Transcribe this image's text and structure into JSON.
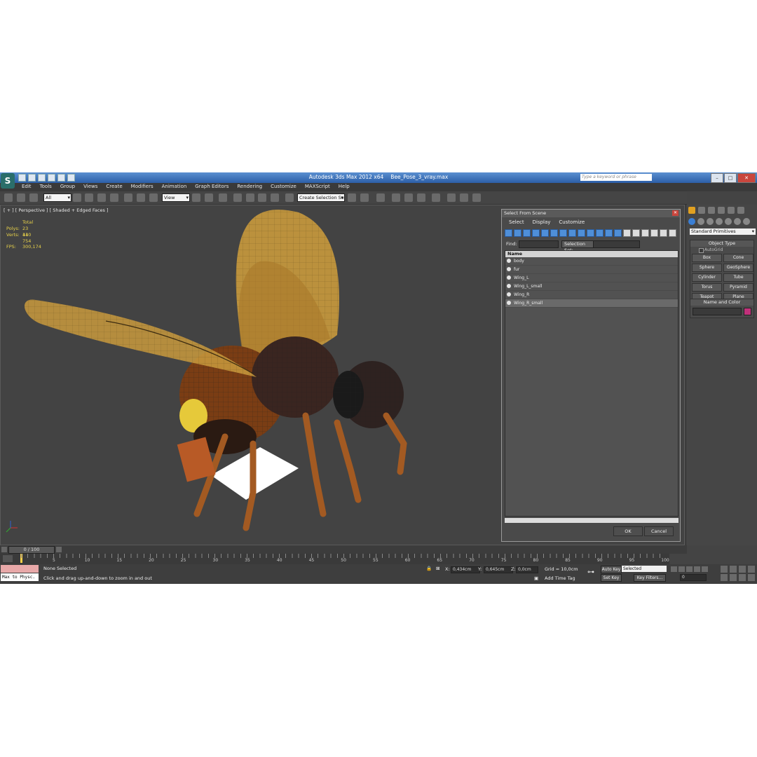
{
  "window": {
    "app_title": "Autodesk 3ds Max  2012 x64",
    "file_name": "Bee_Pose_3_vray.max",
    "search_placeholder": "Type a keyword or phrase",
    "logo_glyph": "S"
  },
  "menu": [
    "Edit",
    "Tools",
    "Group",
    "Views",
    "Create",
    "Modifiers",
    "Animation",
    "Graph Editors",
    "Rendering",
    "Customize",
    "MAXScript",
    "Help"
  ],
  "toolbar": {
    "filter_value": "All",
    "ref_coord_value": "View",
    "selection_set_value": "Create Selection Se"
  },
  "viewport": {
    "label": "[ + ] [ Perspective ] [ Shaded + Edged Faces ]",
    "stats": {
      "total_label": "Total",
      "polys_label": "Polys:",
      "polys_value": "23 440",
      "verts_label": "Verts:",
      "verts_value": "11 754",
      "fps_label": "FPS:",
      "fps_value": "300,174"
    }
  },
  "dialog": {
    "title": "Select From Scene",
    "menu": [
      "Select",
      "Display",
      "Customize"
    ],
    "find_label": "Find:",
    "selection_set_label": "Selection Set:",
    "column_name": "Name",
    "items": [
      "body",
      "fur",
      "Wing_L",
      "Wing_L_small",
      "Wing_R",
      "Wing_R_small"
    ],
    "ok_label": "OK",
    "cancel_label": "Cancel"
  },
  "command_panel": {
    "primitive_type": "Standard Primitives",
    "object_type_header": "Object Type",
    "autogrid_label": "AutoGrid",
    "buttons": [
      "Box",
      "Cone",
      "Sphere",
      "GeoSphere",
      "Cylinder",
      "Tube",
      "Torus",
      "Pyramid",
      "Teapot",
      "Plane"
    ],
    "name_color_header": "Name and Color",
    "color_swatch": "#c0307a"
  },
  "timeline": {
    "slider_label": "0 / 100",
    "ticks": [
      "5",
      "10",
      "15",
      "20",
      "25",
      "30",
      "35",
      "40",
      "45",
      "50",
      "55",
      "60",
      "65",
      "70",
      "75",
      "80",
      "85",
      "90",
      "95",
      "100"
    ]
  },
  "status": {
    "maxscript_text": "Max to Physc.",
    "selection_text": "None Selected",
    "prompt_text": "Click and drag up-and-down to zoom in and out",
    "x_label": "X:",
    "x_value": "0,434cm",
    "y_label": "Y:",
    "y_value": "0,645cm",
    "z_label": "Z:",
    "z_value": "0,0cm",
    "grid_text": "Grid = 10,0cm",
    "add_time_tag": "Add Time Tag",
    "auto_key": "Auto Key",
    "set_key": "Set Key",
    "key_mode_value": "Selected",
    "key_filters": "Key Filters...",
    "frame_value": "0"
  }
}
